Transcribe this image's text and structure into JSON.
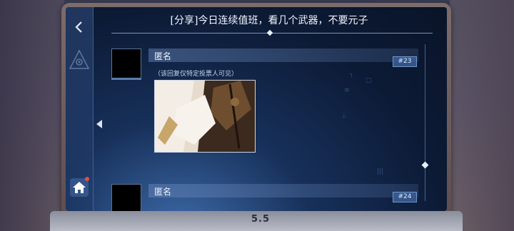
{
  "topic": {
    "title": "[分享]今日连续值班，看几个武器，不要元子"
  },
  "posts": [
    {
      "author": "匿名",
      "floor": "#23",
      "note": "（该回复仅特定投票人可见）",
      "has_image": true
    },
    {
      "author": "匿名",
      "floor": "#24"
    }
  ],
  "device": {
    "brand": "5.5"
  },
  "icons": {
    "back": "back-arrow-icon",
    "emblem": "eye-triangle-emblem-icon",
    "collapse": "collapse-arrow-icon",
    "home": "home-icon"
  },
  "colors": {
    "accent": "#e8f0ff",
    "notification": "#e84a4a"
  }
}
